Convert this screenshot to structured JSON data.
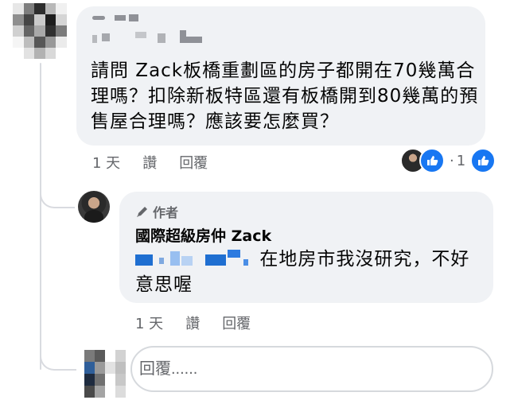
{
  "comment": {
    "text": "請問 Zack板橋重劃區的房子都開在70幾萬合理嗎？扣除新板特區還有板橋開到80幾萬的預售屋合理嗎？應該要怎麼買？",
    "time": "1 天",
    "like_label": "讚",
    "reply_label": "回覆",
    "reaction_separator": "·",
    "reaction_count": "1"
  },
  "reply": {
    "badge": "作者",
    "author": "國際超級房仲 Zack",
    "text": "在地房市我沒研究，不好意思喔",
    "time": "1 天",
    "like_label": "讚",
    "reply_label": "回覆"
  },
  "reply_box": {
    "placeholder": "回覆......"
  },
  "colors": {
    "bubble": "#f0f2f5",
    "secondary_text": "#65676b",
    "facebook_blue": "#1877f2"
  },
  "icons": {
    "badge": "pencil-icon",
    "reaction": "thumbs-up-icon"
  }
}
